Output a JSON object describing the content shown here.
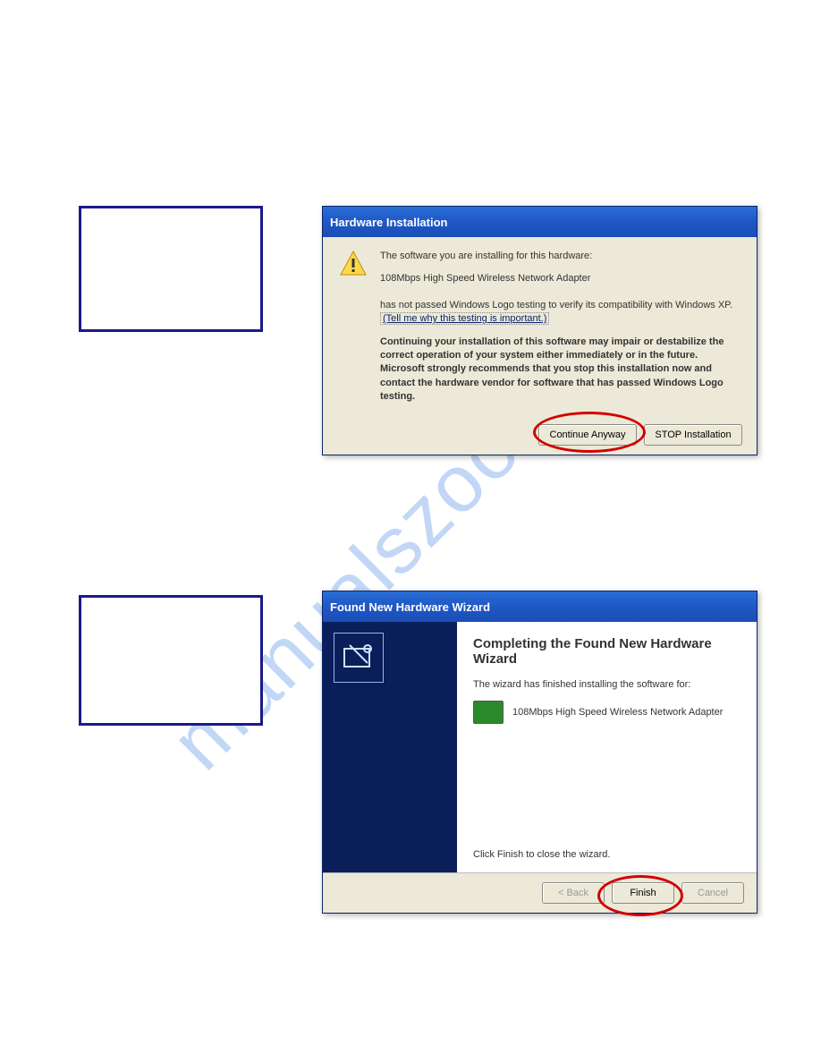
{
  "watermark": "manualszoo.com",
  "dialog1": {
    "title": "Hardware Installation",
    "line1": "The software you are installing for this hardware:",
    "device": "108Mbps High Speed Wireless Network Adapter",
    "notpassed_prefix": "has not passed Windows Logo testing to verify its compatibility with Windows XP. ",
    "link": "(Tell me why this testing is important.)",
    "warning": "Continuing your installation of this software may impair or destabilize the correct operation of your system either immediately or in the future. Microsoft strongly recommends that you stop this installation now and contact the hardware vendor for software that has passed Windows Logo testing.",
    "continue_btn": "Continue Anyway",
    "stop_btn": "STOP Installation"
  },
  "dialog2": {
    "title": "Found New Hardware Wizard",
    "heading": "Completing the Found New Hardware Wizard",
    "subtitle": "The wizard has finished installing the software for:",
    "device": "108Mbps High Speed Wireless Network Adapter",
    "close_hint": "Click Finish to close the wizard.",
    "back_btn": "< Back",
    "finish_btn": "Finish",
    "cancel_btn": "Cancel"
  }
}
